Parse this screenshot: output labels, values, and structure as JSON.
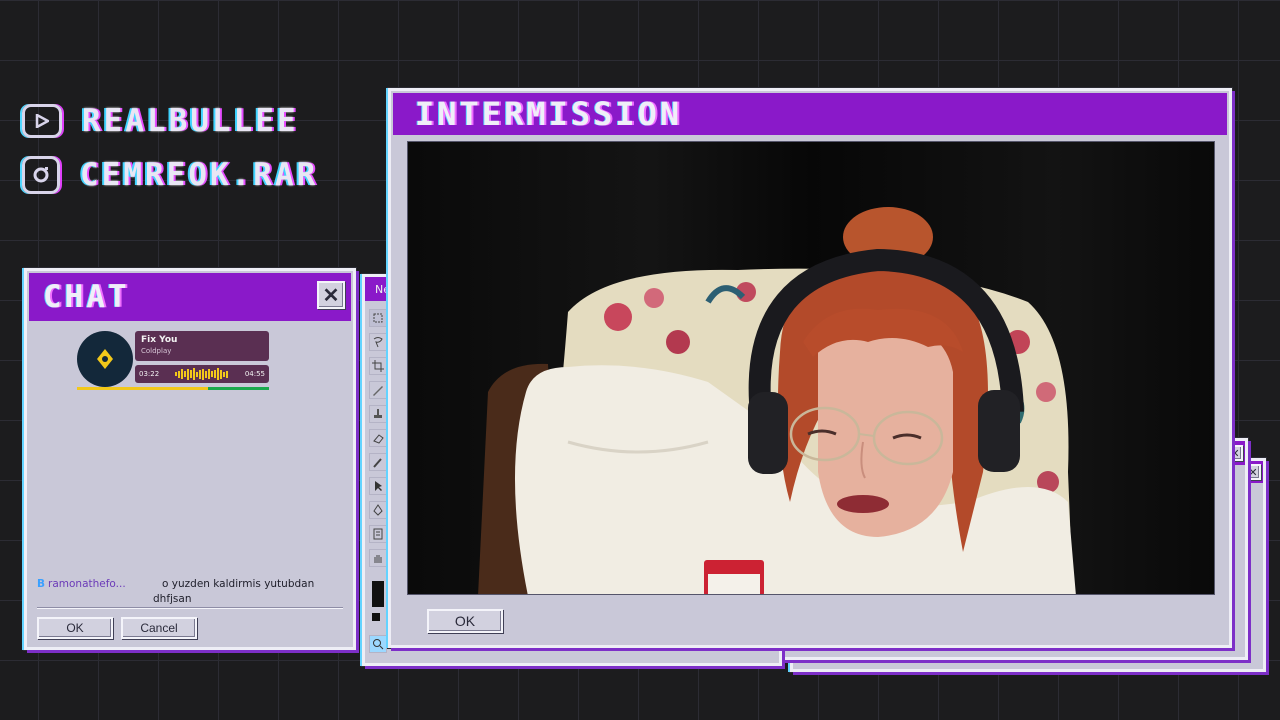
{
  "social": {
    "youtube_handle": "REALBULLEE",
    "instagram_handle": "CEMREOK.RAR"
  },
  "chat": {
    "title": "CHAT",
    "close_glyph": "✕",
    "now_playing": {
      "song": "Fix You",
      "artist": "Coldplay",
      "elapsed": "03:22",
      "duration": "04:55",
      "progress": 0.68
    },
    "message": {
      "badge": "B",
      "username": "ramonathefo...",
      "text_line1": "o yuzden kaldirmis yutubdan",
      "text_line2": "dhfjsan"
    },
    "ok_label": "OK",
    "cancel_label": "Cancel"
  },
  "back_window": {
    "title_fragment": "Ne"
  },
  "main_window": {
    "title": "INTERMISSION",
    "ok_label": "OK"
  },
  "colors": {
    "titlebar": "#8a19c9",
    "window_body": "#c9c8d8",
    "accent_cyan": "#4fd6ff",
    "accent_magenta": "#e040fb",
    "progress_yellow": "#f2c81a",
    "progress_green": "#1aa84c"
  }
}
